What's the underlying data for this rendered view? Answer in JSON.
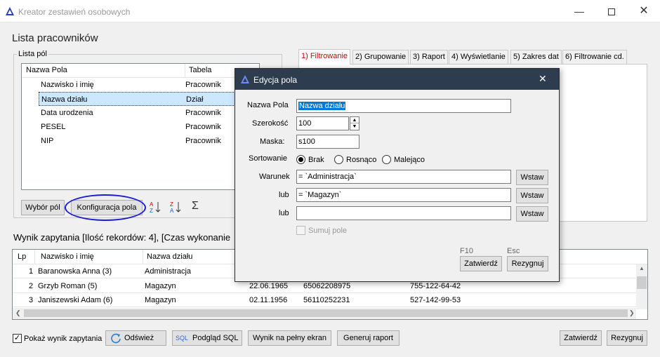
{
  "window": {
    "title": "Kreator zestawień osobowych"
  },
  "page_title": "Lista pracowników",
  "fields_group": {
    "label": "Lista pól",
    "headers": [
      "Nazwa Pola",
      "Tabela"
    ],
    "rows": [
      {
        "name": "Nazwisko i imię",
        "table": "Pracownik"
      },
      {
        "name": "Nazwa działu",
        "table": "Dział"
      },
      {
        "name": "Data urodzenia",
        "table": "Pracownik"
      },
      {
        "name": "PESEL",
        "table": "Pracownik"
      },
      {
        "name": "NIP",
        "table": "Pracownik"
      }
    ],
    "btn_select": "Wybór pól",
    "btn_config": "Konfiguracja pola"
  },
  "tabs": [
    "1) Filtrowanie",
    "2) Grupowanie",
    "3) Raport",
    "4) Wyświetlanie",
    "5) Zakres dat",
    "6) Filtrowanie cd."
  ],
  "result_label": "Wynik zapytania [Ilość rekordów: 4], [Czas wykonanie",
  "grid": {
    "headers": [
      "Lp",
      "Nazwisko i imię",
      "Nazwa działu"
    ],
    "rows": [
      {
        "lp": "1",
        "name": "Baranowska Anna (3)",
        "dept": "Administracja",
        "date": "",
        "pesel": "",
        "nip": ""
      },
      {
        "lp": "2",
        "name": "Grzyb Roman (5)",
        "dept": "Magazyn",
        "date": "22.06.1965",
        "pesel": "65062208975",
        "nip": "755-122-64-42"
      },
      {
        "lp": "3",
        "name": "Janiszewski Adam (6)",
        "dept": "Magazyn",
        "date": "02.11.1956",
        "pesel": "56110252231",
        "nip": "527-142-99-53"
      }
    ]
  },
  "bottom": {
    "show_result": "Pokaż wynik zapytania",
    "refresh": "Odśwież",
    "sql_icon": "SQL",
    "sql_preview": "Podgląd SQL",
    "fullscreen": "Wynik na pełny ekran",
    "generate": "Generuj raport",
    "confirm": "Zatwierdź",
    "cancel": "Rezygnuj"
  },
  "dialog": {
    "title": "Edycja pola",
    "name_label": "Nazwa Pola",
    "name_value": "Nazwa działu",
    "width_label": "Szerokość",
    "width_value": "100",
    "mask_label": "Maska:",
    "mask_value": "s100",
    "sort_label": "Sortowanie",
    "sort_options": [
      "Brak",
      "Rosnąco",
      "Malejąco"
    ],
    "cond_label": "Warunek",
    "cond_value": "= `Administracja`",
    "or1_label": "lub",
    "or1_value": "= `Magazyn`",
    "or2_label": "lub",
    "or2_value": "",
    "insert": "Wstaw",
    "sum_label": "Sumuj pole",
    "key_confirm": "F10",
    "key_cancel": "Esc",
    "confirm": "Zatwierdź",
    "cancel": "Rezygnuj"
  },
  "colors": {
    "selection": "#0078d7",
    "row_selected": "#cce8ff",
    "dialog_title": "#2e3c4f",
    "highlight_circle": "#1a1ad6"
  }
}
